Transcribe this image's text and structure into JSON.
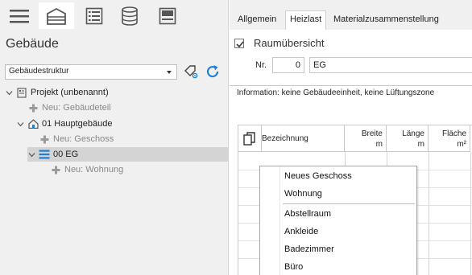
{
  "left_panel": {
    "toolbar": [
      {
        "icon": "hamburger-menu-icon"
      },
      {
        "icon": "building-icon",
        "active": true
      },
      {
        "icon": "list-icon"
      },
      {
        "icon": "database-icon"
      },
      {
        "icon": "panel-icon"
      }
    ],
    "title": "Gebäude",
    "structure_select": {
      "value": "Gebäudestruktur"
    },
    "tree": [
      {
        "label": "Projekt (unbenannt)",
        "icon": "project-icon",
        "expanded": true
      },
      {
        "label": "Neu: Gebäudeteil",
        "icon": "add-icon"
      },
      {
        "label": "01 Hauptgebäude",
        "icon": "house-icon",
        "expanded": true
      },
      {
        "label": "Neu: Geschoss",
        "icon": "add-icon"
      },
      {
        "label": "00 EG",
        "icon": "floor-icon",
        "expanded": true,
        "selected": true
      },
      {
        "label": "Neu: Wohnung",
        "icon": "add-icon"
      }
    ]
  },
  "tabs": [
    {
      "label": "Allgemein"
    },
    {
      "label": "Heizlast",
      "active": true
    },
    {
      "label": "Materialzusammenstellung"
    }
  ],
  "form": {
    "room_overview": {
      "label": "Raumübersicht",
      "checked": true
    },
    "nr_label": "Nr.",
    "nr_value": "0",
    "name_value": "EG",
    "info": "Information: keine Gebäudeeinheit, keine Lüftungszone"
  },
  "grid": {
    "columns": [
      {
        "title": "Bezeichnung",
        "unit": ""
      },
      {
        "title": "Breite",
        "unit": "m"
      },
      {
        "title": "Länge",
        "unit": "m"
      },
      {
        "title": "Fläche",
        "unit": "m²"
      }
    ]
  },
  "context_menu": {
    "group1": [
      "Neues Geschoss",
      "Wohnung"
    ],
    "group2": [
      "Abstellraum",
      "Ankleide",
      "Badezimmer",
      "Büro"
    ]
  },
  "colors": {
    "accent": "#1e7fd6",
    "selected_row": "#d4d4d4",
    "panel_bg": "#f0f0f0"
  }
}
